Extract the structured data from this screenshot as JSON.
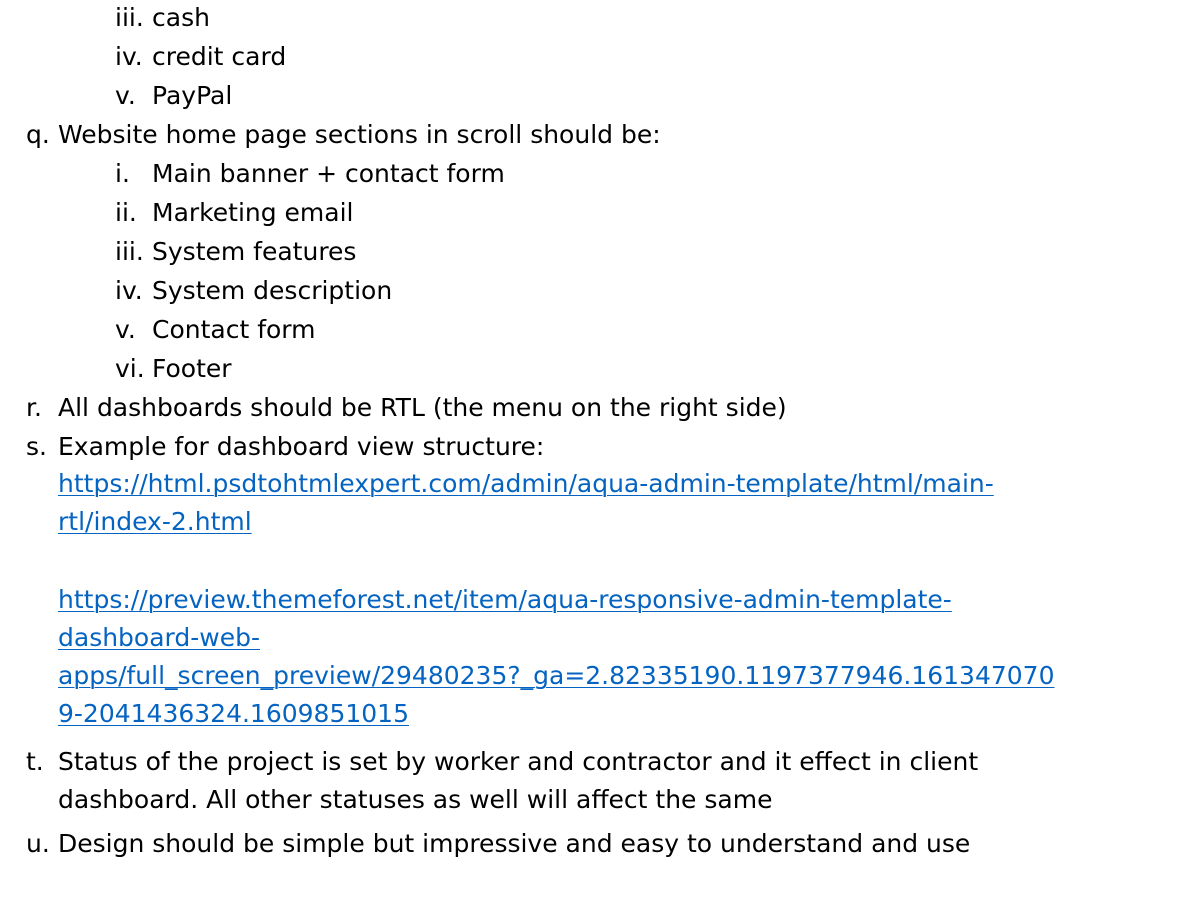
{
  "document": {
    "payment_methods": [
      {
        "marker": "iii.",
        "text": "cash"
      },
      {
        "marker": "iv.",
        "text": "credit card"
      },
      {
        "marker": "v.",
        "text": "PayPal"
      }
    ],
    "item_q": {
      "marker": "q.",
      "text": "Website home page sections in scroll should be:",
      "subitems": [
        {
          "marker": "i.",
          "text": "Main banner + contact form"
        },
        {
          "marker": "ii.",
          "text": "Marketing email"
        },
        {
          "marker": "iii.",
          "text": "System features"
        },
        {
          "marker": "iv.",
          "text": "System description"
        },
        {
          "marker": "v.",
          "text": "Contact form"
        },
        {
          "marker": "vi.",
          "text": "Footer"
        }
      ]
    },
    "item_r": {
      "marker": "r.",
      "text": "All dashboards should be RTL (the menu on the right side)"
    },
    "item_s": {
      "marker": "s.",
      "text": "Example for dashboard view structure:",
      "link1": {
        "line1": "https://html.psdtohtmlexpert.com/admin/aqua-admin-template/html/main-",
        "line2": "rtl/index-2.html"
      },
      "link2": {
        "line1": "https://preview.themeforest.net/item/aqua-responsive-admin-template-",
        "line2": "dashboard-web-",
        "line3": "apps/full_screen_preview/29480235?_ga=2.82335190.1197377946.161347070",
        "line4": "9-2041436324.1609851015"
      }
    },
    "item_t": {
      "marker": "t.",
      "line1": "Status of the project is set by worker and contractor and it effect in client",
      "line2": "dashboard. All other statuses as well will affect the same"
    },
    "item_u": {
      "marker": "u.",
      "text": "Design should be simple but impressive and easy to understand and use"
    }
  },
  "colors": {
    "text": "#000000",
    "link": "#0563c1",
    "background": "#ffffff"
  }
}
